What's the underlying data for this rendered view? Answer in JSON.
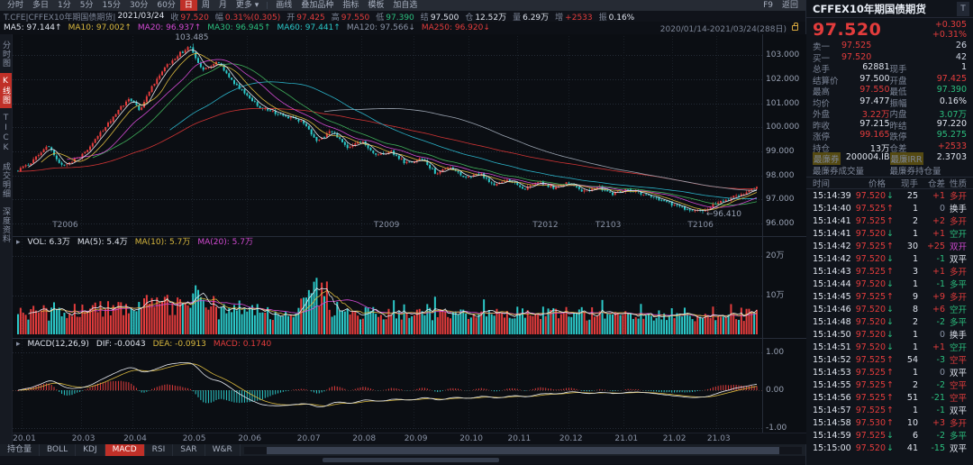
{
  "palette": {
    "red": "#e33c3c",
    "green": "#2bbf7e",
    "cyan": "#2bc8c8",
    "yellow": "#d9b83e",
    "magenta": "#d24ad2",
    "white": "#dfe4ee",
    "grey": "#8a93a6",
    "red_bg": "#c03028"
  },
  "toolbar": {
    "left_items": [
      {
        "label": "分时"
      },
      {
        "label": "多日"
      },
      {
        "label": "1分"
      },
      {
        "label": "5分"
      },
      {
        "label": "15分"
      },
      {
        "label": "30分"
      },
      {
        "label": "60分"
      },
      {
        "label": "日",
        "active": true
      },
      {
        "label": "周"
      },
      {
        "label": "月"
      },
      {
        "label": "更多",
        "caret": "▾"
      }
    ],
    "mid_items": [
      {
        "label": "画线"
      },
      {
        "label": "叠加品种"
      },
      {
        "label": "指标"
      },
      {
        "label": "模板"
      },
      {
        "label": "加自选"
      }
    ],
    "right_items": [
      {
        "label": "F9"
      },
      {
        "label": "返回"
      }
    ]
  },
  "info_row": {
    "symbol": "T.CFE|CFFEX10年期国债期货|",
    "date": "2021/03/24",
    "fields": [
      {
        "label": "收",
        "value": "97.520",
        "color": "red"
      },
      {
        "label": "幅",
        "value": "0.31%(0.305)",
        "color": "red"
      },
      {
        "label": "开",
        "value": "97.425",
        "color": "red"
      },
      {
        "label": "高",
        "value": "97.550",
        "color": "red"
      },
      {
        "label": "低",
        "value": "97.390",
        "color": "green"
      },
      {
        "label": "结",
        "value": "97.500",
        "color": "white"
      },
      {
        "label": "仓",
        "value": "12.52万",
        "color": "white"
      },
      {
        "label": "量",
        "value": "6.29万",
        "color": "white"
      },
      {
        "label": "增",
        "value": "+2533",
        "color": "red"
      },
      {
        "label": "振",
        "value": "0.16%",
        "color": "white"
      }
    ]
  },
  "ma_row": {
    "items": [
      {
        "label": "MA5:",
        "value": "97.144",
        "dir": "↑",
        "color": "white"
      },
      {
        "label": "MA10:",
        "value": "97.002",
        "dir": "↑",
        "color": "yellow"
      },
      {
        "label": "MA20:",
        "value": "96.937",
        "dir": "↑",
        "color": "magenta"
      },
      {
        "label": "MA30:",
        "value": "96.945",
        "dir": "↑",
        "color": "green"
      },
      {
        "label": "MA60:",
        "value": "97.441",
        "dir": "↑",
        "color": "cyan"
      },
      {
        "label": "MA120:",
        "value": "97.566",
        "dir": "↓",
        "color": "grey"
      },
      {
        "label": "MA250:",
        "value": "96.920",
        "dir": "↓",
        "color": "red"
      }
    ],
    "range": "2020/01/14-2021/03/24(288日)"
  },
  "sidebar": {
    "items": [
      {
        "label": "分时图"
      },
      {
        "label": "K线图",
        "active": true
      },
      {
        "label": "TICK"
      },
      {
        "label": "成交明细"
      },
      {
        "label": "深度资料"
      }
    ]
  },
  "vol_header": {
    "arrow": "▸",
    "vol_label": "VOL:",
    "vol_value": "6.3万",
    "mas": [
      {
        "label": "MA(5):",
        "value": "5.4万",
        "color": "white"
      },
      {
        "label": "MA(10):",
        "value": "5.7万",
        "color": "yellow"
      },
      {
        "label": "MA(20):",
        "value": "5.7万",
        "color": "magenta"
      }
    ]
  },
  "macd_header": {
    "arrow": "▸",
    "name": "MACD(12,26,9)",
    "items": [
      {
        "label": "DIF:",
        "value": "-0.0043",
        "color": "white"
      },
      {
        "label": "DEA:",
        "value": "-0.0913",
        "color": "yellow"
      },
      {
        "label": "MACD:",
        "value": "0.1740",
        "color": "red"
      }
    ]
  },
  "bottom_tabs": {
    "items": [
      {
        "label": "持仓量"
      },
      {
        "label": "BOLL"
      },
      {
        "label": "KDJ"
      },
      {
        "label": "MACD",
        "active": true
      },
      {
        "label": "RSI"
      },
      {
        "label": "SAR"
      },
      {
        "label": "W&R"
      }
    ]
  },
  "quote_panel": {
    "title": "CFFEX10年期国债期货",
    "side_tab": "T",
    "last": "97.520",
    "change": "+0.305",
    "change_pct": "+0.31%",
    "ask": {
      "label": "卖一",
      "price": "97.525",
      "qty": "26"
    },
    "bid": {
      "label": "买一",
      "price": "97.520",
      "qty": "42"
    },
    "grid": [
      [
        {
          "label": "总手",
          "value": "62881",
          "color": "white"
        },
        {
          "label": "现手",
          "value": "1",
          "color": "white"
        }
      ],
      [
        {
          "label": "结算价",
          "value": "97.500",
          "color": "white"
        },
        {
          "label": "开盘",
          "value": "97.425",
          "color": "red"
        }
      ],
      [
        {
          "label": "最高",
          "value": "97.550",
          "color": "red"
        },
        {
          "label": "最低",
          "value": "97.390",
          "color": "green"
        }
      ],
      [
        {
          "label": "均价",
          "value": "97.477",
          "color": "white"
        },
        {
          "label": "振幅",
          "value": "0.16%",
          "color": "white"
        }
      ],
      [
        {
          "label": "外盘",
          "value": "3.22万",
          "color": "red"
        },
        {
          "label": "内盘",
          "value": "3.07万",
          "color": "green"
        }
      ],
      [
        {
          "label": "昨收",
          "value": "97.215",
          "color": "white"
        },
        {
          "label": "昨结",
          "value": "97.220",
          "color": "white"
        }
      ],
      [
        {
          "label": "涨停",
          "value": "99.165",
          "color": "red"
        },
        {
          "label": "跌停",
          "value": "95.275",
          "color": "green"
        }
      ],
      [
        {
          "label": "持仓",
          "value": "13万",
          "color": "white"
        },
        {
          "label": "仓差",
          "value": "+2533",
          "color": "red"
        }
      ],
      [
        {
          "label": "最廉券",
          "value": "200004.IB",
          "color": "white",
          "hl": true
        },
        {
          "label": "最廉IRR",
          "value": "2.3703",
          "color": "white",
          "hl": true
        }
      ]
    ],
    "dim_row": [
      "最廉券成交量",
      "最廉券持仓量"
    ],
    "tick_table": {
      "headers": [
        "时间",
        "价格",
        "现手",
        "仓差",
        "性质"
      ],
      "nature_colors": {
        "多开": "red",
        "空开": "green",
        "多平": "green",
        "空平": "red",
        "双开": "magenta",
        "双平": "white",
        "换手": "white"
      },
      "rows": [
        [
          "15:14:39",
          "97.520",
          "↓",
          "25",
          "+1",
          "多开"
        ],
        [
          "15:14:40",
          "97.525",
          "↑",
          "1",
          "0",
          "换手"
        ],
        [
          "15:14:41",
          "97.525",
          "↑",
          "2",
          "+2",
          "多开"
        ],
        [
          "15:14:41",
          "97.520",
          "↓",
          "1",
          "+1",
          "空开"
        ],
        [
          "15:14:42",
          "97.525",
          "↑",
          "30",
          "+25",
          "双开"
        ],
        [
          "15:14:42",
          "97.520",
          "↓",
          "1",
          "-1",
          "双平"
        ],
        [
          "15:14:43",
          "97.525",
          "↑",
          "3",
          "+1",
          "多开"
        ],
        [
          "15:14:44",
          "97.520",
          "↓",
          "1",
          "-1",
          "多平"
        ],
        [
          "15:14:45",
          "97.525",
          "↑",
          "9",
          "+9",
          "多开"
        ],
        [
          "15:14:46",
          "97.520",
          "↓",
          "8",
          "+6",
          "空开"
        ],
        [
          "15:14:48",
          "97.520",
          "↓",
          "2",
          "-2",
          "多平"
        ],
        [
          "15:14:50",
          "97.520",
          "↓",
          "1",
          "0",
          "换手"
        ],
        [
          "15:14:51",
          "97.520",
          "↓",
          "1",
          "+1",
          "空开"
        ],
        [
          "15:14:52",
          "97.525",
          "↑",
          "54",
          "-3",
          "空平"
        ],
        [
          "15:14:53",
          "97.525",
          "↑",
          "1",
          "0",
          "双平"
        ],
        [
          "15:14:55",
          "97.525",
          "↑",
          "2",
          "-2",
          "空平"
        ],
        [
          "15:14:56",
          "97.525",
          "↑",
          "51",
          "-21",
          "空平"
        ],
        [
          "15:14:57",
          "97.525",
          "↑",
          "1",
          "-1",
          "双平"
        ],
        [
          "15:14:58",
          "97.530",
          "↑",
          "10",
          "+3",
          "多开"
        ],
        [
          "15:14:59",
          "97.525",
          "↓",
          "6",
          "-2",
          "多平"
        ],
        [
          "15:15:00",
          "97.520",
          "↓",
          "41",
          "-15",
          "双平"
        ]
      ]
    }
  },
  "chart_data": {
    "type": "candlestick",
    "panels": [
      "price+ma",
      "volume",
      "macd"
    ],
    "bars": 288,
    "seed": 11,
    "price_range": [
      95.7,
      103.8
    ],
    "price_ticks": [
      {
        "v": 103,
        "t": "103.000"
      },
      {
        "v": 102,
        "t": "102.000"
      },
      {
        "v": 101,
        "t": "101.000"
      },
      {
        "v": 100,
        "t": "100.000"
      },
      {
        "v": 99,
        "t": "99.000"
      },
      {
        "v": 98,
        "t": "98.000"
      },
      {
        "v": 97,
        "t": "97.000"
      },
      {
        "v": 96,
        "t": "96.000"
      }
    ],
    "high": {
      "value": 103.485,
      "label": "103.485"
    },
    "low": {
      "value": 96.41,
      "label": "←96.410"
    },
    "last_close": 97.52,
    "last_open": 97.455,
    "close_anchors": [
      [
        0,
        98.2
      ],
      [
        0.02,
        98.6
      ],
      [
        0.04,
        99.3
      ],
      [
        0.06,
        98.35
      ],
      [
        0.09,
        98.9
      ],
      [
        0.11,
        99.7
      ],
      [
        0.13,
        100.5
      ],
      [
        0.15,
        101.2
      ],
      [
        0.165,
        100.7
      ],
      [
        0.18,
        101.6
      ],
      [
        0.2,
        102.5
      ],
      [
        0.22,
        103.1
      ],
      [
        0.233,
        103.35
      ],
      [
        0.25,
        102.35
      ],
      [
        0.27,
        102.75
      ],
      [
        0.29,
        101.95
      ],
      [
        0.31,
        101.3
      ],
      [
        0.33,
        100.8
      ],
      [
        0.36,
        100.45
      ],
      [
        0.385,
        100.2
      ],
      [
        0.405,
        99.45
      ],
      [
        0.425,
        99.85
      ],
      [
        0.445,
        99.15
      ],
      [
        0.465,
        99.4
      ],
      [
        0.485,
        98.8
      ],
      [
        0.505,
        99.0
      ],
      [
        0.525,
        98.5
      ],
      [
        0.545,
        98.7
      ],
      [
        0.565,
        98.1
      ],
      [
        0.585,
        98.35
      ],
      [
        0.605,
        97.9
      ],
      [
        0.625,
        98.1
      ],
      [
        0.645,
        97.6
      ],
      [
        0.665,
        97.85
      ],
      [
        0.685,
        97.45
      ],
      [
        0.705,
        97.7
      ],
      [
        0.725,
        97.5
      ],
      [
        0.745,
        97.75
      ],
      [
        0.765,
        97.3
      ],
      [
        0.785,
        97.55
      ],
      [
        0.805,
        97.2
      ],
      [
        0.825,
        97.45
      ],
      [
        0.845,
        97.25
      ],
      [
        0.865,
        97.05
      ],
      [
        0.885,
        96.8
      ],
      [
        0.905,
        96.6
      ],
      [
        0.925,
        96.5
      ],
      [
        0.945,
        96.85
      ],
      [
        0.965,
        97.05
      ],
      [
        0.985,
        97.3
      ],
      [
        1,
        97.52
      ]
    ],
    "volume_max": 21,
    "volume_ticks": [
      {
        "v": 20,
        "t": "20万"
      },
      {
        "v": 10,
        "t": "10万"
      }
    ],
    "last_volume": 6.29,
    "macd_ticks": [
      {
        "v": 1,
        "t": "1.00"
      },
      {
        "v": 0,
        "t": "0.00"
      },
      {
        "v": -1,
        "t": "-1.00"
      }
    ],
    "contracts": [
      {
        "label": "T2006",
        "f": 0.06
      },
      {
        "label": "T2009",
        "f": 0.495
      },
      {
        "label": "T2012",
        "f": 0.71
      },
      {
        "label": "T2103",
        "f": 0.795
      },
      {
        "label": "T2106",
        "f": 0.92
      }
    ],
    "x_labels": [
      {
        "t": "20.01",
        "f": 0.005
      },
      {
        "t": "20.03",
        "f": 0.085
      },
      {
        "t": "20.04",
        "f": 0.155
      },
      {
        "t": "20.05",
        "f": 0.235
      },
      {
        "t": "20.06",
        "f": 0.31
      },
      {
        "t": "20.07",
        "f": 0.39
      },
      {
        "t": "20.08",
        "f": 0.465
      },
      {
        "t": "20.09",
        "f": 0.535
      },
      {
        "t": "20.10",
        "f": 0.61
      },
      {
        "t": "20.11",
        "f": 0.675
      },
      {
        "t": "20.12",
        "f": 0.745
      },
      {
        "t": "21.01",
        "f": 0.82
      },
      {
        "t": "21.02",
        "f": 0.885
      },
      {
        "t": "21.03",
        "f": 0.945
      }
    ],
    "ma_colors": {
      "ma5": "#e6e9f0",
      "ma10": "#d9b83e",
      "ma20": "#d24ad2",
      "ma30": "#3fae5a",
      "ma60": "#2bb3c9",
      "ma120": "#9aa3b0",
      "ma250": "#cf3434"
    },
    "up_color": "#e33c3c",
    "down_color": "#2bc8c8"
  }
}
